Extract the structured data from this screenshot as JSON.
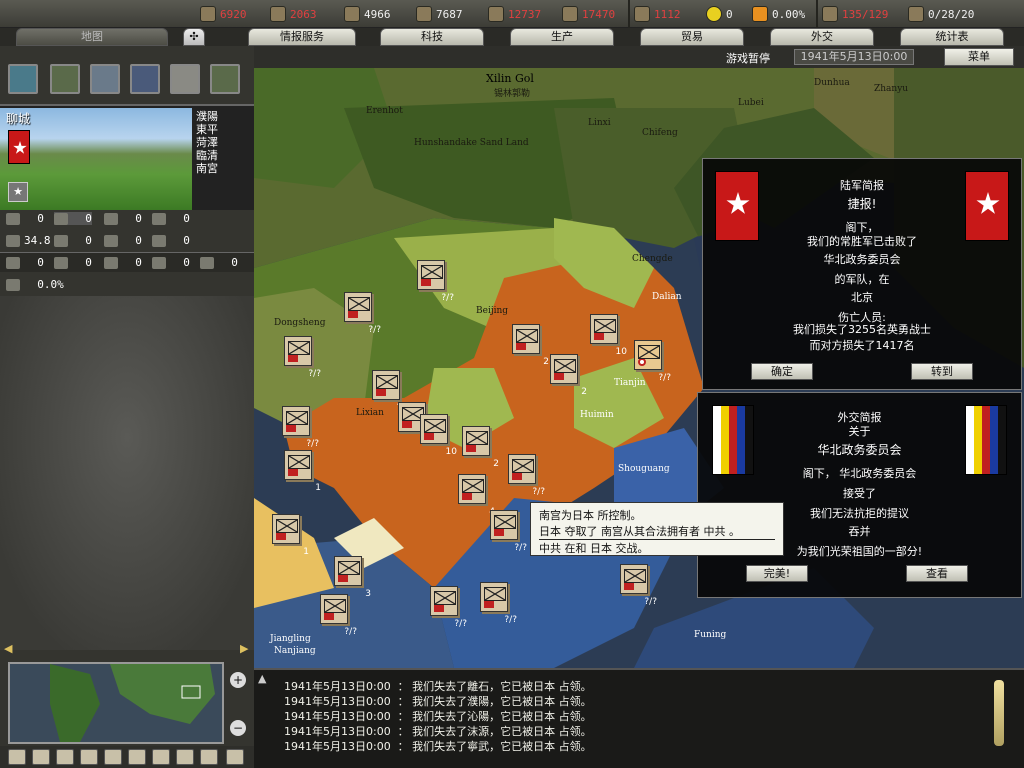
{
  "resources": [
    {
      "icon": "energy-icon",
      "value": "6920",
      "class": "neg"
    },
    {
      "icon": "metal-icon",
      "value": "2063",
      "class": "neg"
    },
    {
      "icon": "rare-materials-icon",
      "value": "4966",
      "class": "pos"
    },
    {
      "icon": "oil-icon",
      "value": "7687",
      "class": "pos"
    },
    {
      "icon": "supplies-icon",
      "value": "12737",
      "class": "neg"
    },
    {
      "icon": "money-icon",
      "value": "17470",
      "class": "neg"
    },
    {
      "icon": "manpower-icon",
      "value": "1112",
      "class": "neg"
    },
    {
      "icon": "nuclear-icon",
      "value": "0",
      "class": "pos"
    },
    {
      "icon": "dissent-icon",
      "value": "0.00%",
      "class": "pos"
    },
    {
      "icon": "transport-icon",
      "value": "135/129",
      "class": "neg"
    },
    {
      "icon": "escort-icon",
      "value": "0/28/20",
      "class": "pos"
    }
  ],
  "tabs": {
    "map": "地图",
    "intelligence": "情报服务",
    "technology": "科技",
    "production": "生产",
    "trade": "贸易",
    "diplomacy": "外交",
    "statistics": "统计表"
  },
  "subbar": {
    "pause": "游戏暂停",
    "date": "1941年5月13日0:00",
    "menu": "菜单"
  },
  "province": {
    "name": "聊城",
    "neighbors": [
      "濮陽",
      "東平",
      "菏澤",
      "臨清",
      "南宮"
    ],
    "stats_row1": [
      "0",
      "0",
      "0",
      "0"
    ],
    "stats_row2": [
      "34.8",
      "0",
      "0",
      "0"
    ],
    "stats_row3": [
      "0",
      "0",
      "0",
      "0",
      "0"
    ],
    "dissent": "0.0%"
  },
  "map_labels": [
    {
      "text": "Xilin Gol"
    },
    {
      "text": "锡林郭勒"
    },
    {
      "text": "Erenhot"
    },
    {
      "text": "Chifeng"
    },
    {
      "text": "Hunshandake Sand Land"
    },
    {
      "text": "Dongsheng"
    },
    {
      "text": "Lixian"
    },
    {
      "text": "Huimin"
    },
    {
      "text": "Shouguang"
    },
    {
      "text": "Funing"
    },
    {
      "text": "Jiangling"
    },
    {
      "text": "Nanjiang"
    },
    {
      "text": "Dunhua"
    },
    {
      "text": "Zhanyu"
    },
    {
      "text": "Chengde"
    },
    {
      "text": "Dalian"
    },
    {
      "text": "Beijing"
    },
    {
      "text": "Tianjin"
    },
    {
      "text": "Linxi"
    },
    {
      "text": "Lubei"
    }
  ],
  "army_report": {
    "heading": "陆军简报",
    "title": "捷报!",
    "lines": [
      "阁下，",
      "我们的常胜军已击败了",
      "华北政务委员会",
      "的军队，在",
      "北京",
      "伤亡人员:",
      "我们损失了3255名英勇战士",
      "而对方损失了1417名"
    ],
    "ok": "确定",
    "goto": "转到"
  },
  "diplo_report": {
    "heading": "外交简报",
    "about": "关于",
    "country": "华北政务委员会",
    "lines": [
      "阁下，  华北政务委员会",
      "接受了",
      "我们无法抗拒的提议",
      "吞并",
      "为我们光荣祖国的一部分!"
    ],
    "ok": "完美!",
    "view": "查看"
  },
  "tooltip": {
    "line1": "南宫为日本 所控制。",
    "line2": "日本 夺取了 南宫从其合法拥有者 中共 。",
    "line3": "中共 在和 日本 交战。"
  },
  "log": [
    "1941年5月13日0:00  ： 我们失去了離石，它已被日本 占领。",
    "1941年5月13日0:00  ： 我们失去了濮陽，它已被日本 占领。",
    "1941年5月13日0:00  ： 我们失去了沁陽，它已被日本 占领。",
    "1941年5月13日0:00  ： 我们失去了沫源，它已被日本 占领。",
    "1941年5月13日0:00  ： 我们失去了寧武，它已被日本 占领。"
  ],
  "counter_labels": [
    "?/?",
    "?/?",
    "?/?",
    "2",
    "10",
    "?/?",
    "?/?",
    "2",
    "?/?",
    "?/?",
    "10",
    "2",
    "?/?",
    "1",
    "4",
    "?/?",
    "1",
    "3",
    "?/?",
    "?/?",
    "?/?",
    "?/?"
  ],
  "colors": {
    "japan_territory": "#c8641e",
    "china_light": "#a0b850",
    "sea": "#2a3a50",
    "neutral": "#4a6a30",
    "accent_red": "#c81818"
  }
}
